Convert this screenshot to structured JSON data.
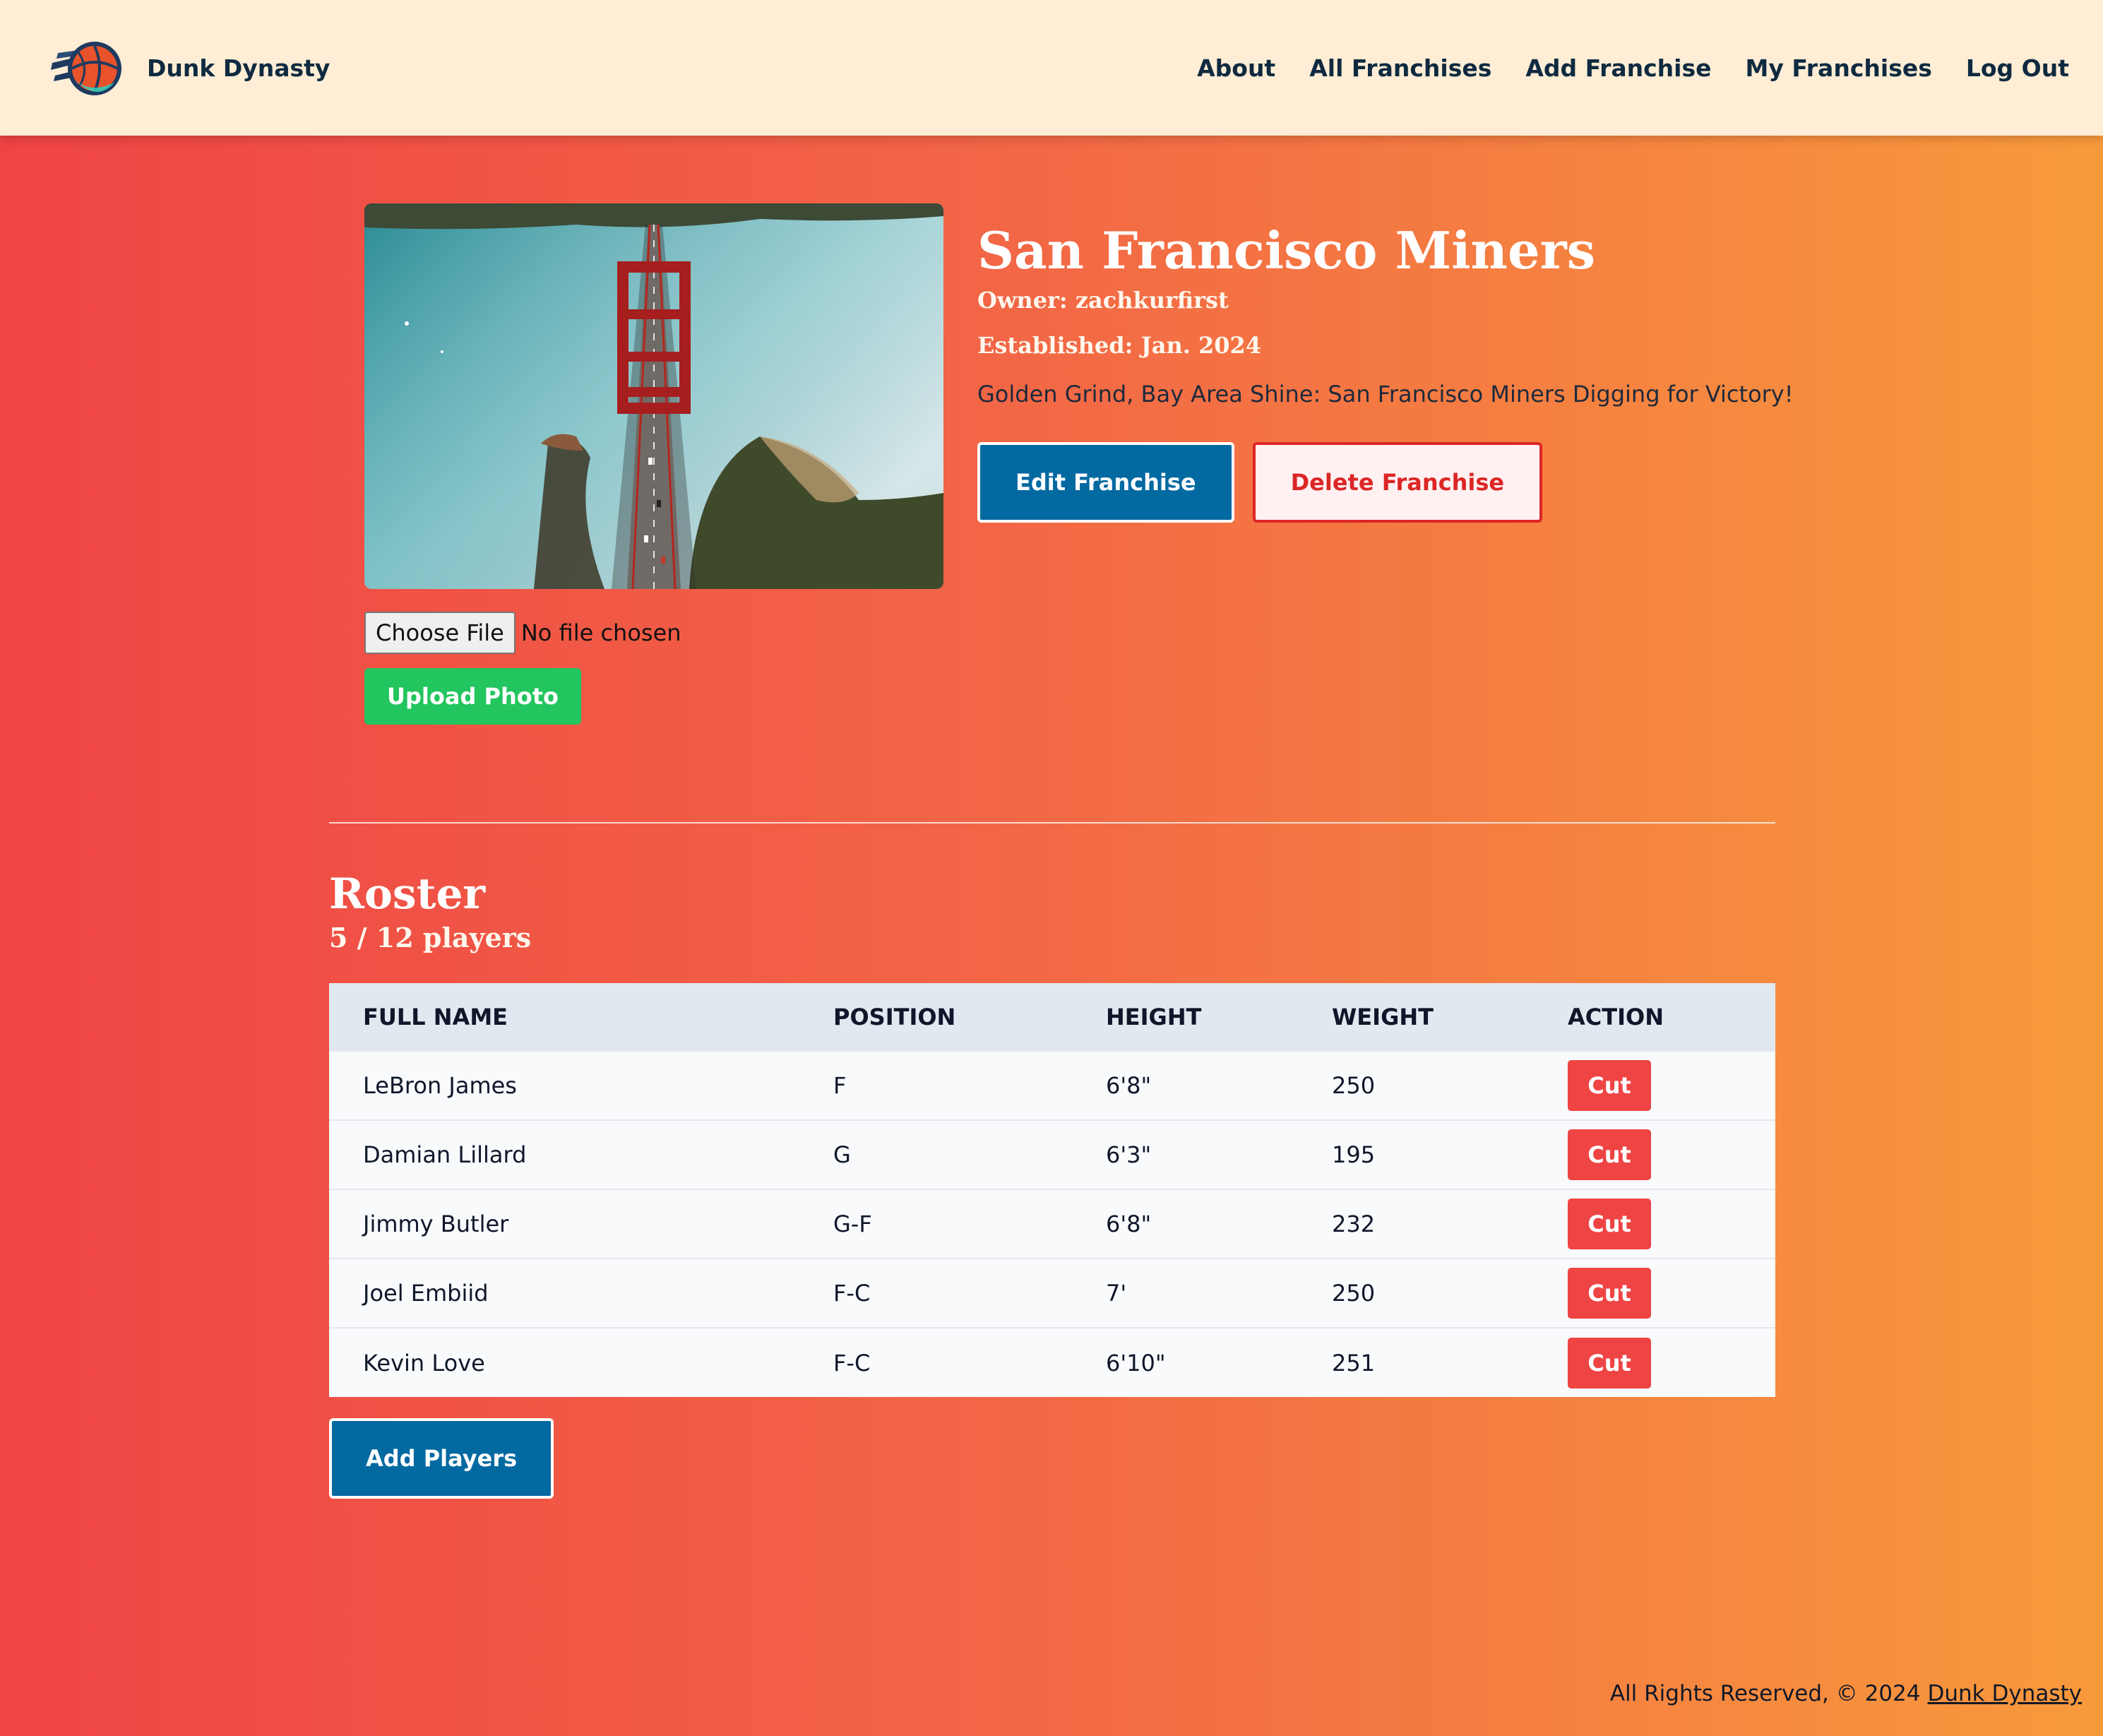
{
  "brand": {
    "name": "Dunk Dynasty",
    "logo_icon": "basketball-logo-icon"
  },
  "nav": {
    "links": [
      "About",
      "All Franchises",
      "Add Franchise",
      "My Franchises",
      "Log Out"
    ]
  },
  "franchise": {
    "photo_icon": "golden-gate-bridge-aerial-photo",
    "name": "San Francisco Miners",
    "owner": "Owner: zachkurfirst",
    "established": "Established: Jan. 2024",
    "slogan": "Golden Grind, Bay Area Shine: San Francisco Miners Digging for Victory!",
    "edit_label": "Edit Franchise",
    "delete_label": "Delete Franchise"
  },
  "upload": {
    "choose_label": "Choose File",
    "status": "No file chosen",
    "upload_label": "Upload Photo"
  },
  "roster": {
    "title": "Roster",
    "count": "5 / 12 players",
    "columns": [
      "FULL NAME",
      "POSITION",
      "HEIGHT",
      "WEIGHT",
      "ACTION"
    ],
    "rows": [
      {
        "name": "LeBron James",
        "position": "F",
        "height": "6'8\"",
        "weight": "250",
        "action": "Cut"
      },
      {
        "name": "Damian Lillard",
        "position": "G",
        "height": "6'3\"",
        "weight": "195",
        "action": "Cut"
      },
      {
        "name": "Jimmy Butler",
        "position": "G-F",
        "height": "6'8\"",
        "weight": "232",
        "action": "Cut"
      },
      {
        "name": "Joel Embiid",
        "position": "F-C",
        "height": "7'",
        "weight": "250",
        "action": "Cut"
      },
      {
        "name": "Kevin Love",
        "position": "F-C",
        "height": "6'10\"",
        "weight": "251",
        "action": "Cut"
      }
    ],
    "add_label": "Add Players"
  },
  "footer": {
    "text": "All Rights Reserved, © 2024",
    "link": "Dunk Dynasty"
  },
  "colors": {
    "gradient_start": "#ef4444",
    "gradient_end": "#f89a3c",
    "navbar_bg": "#ffedd5",
    "primary_button": "#0369a1",
    "danger": "#dc2626",
    "success": "#22c55e"
  }
}
